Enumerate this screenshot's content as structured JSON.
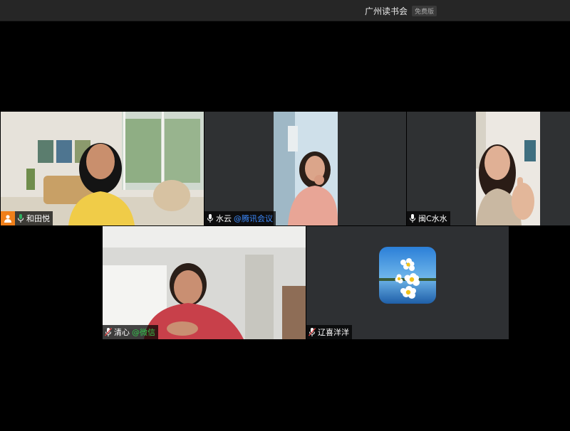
{
  "window": {
    "title": "广州读书会",
    "edition_badge": "免费版"
  },
  "participants": [
    {
      "name": "和田悦",
      "source": "",
      "speaking": true,
      "host": true,
      "video": true
    },
    {
      "name": "水云",
      "source": "@腾讯会议",
      "speaking": false,
      "host": false,
      "video": true
    },
    {
      "name": "闽C水水",
      "source": "",
      "speaking": false,
      "host": false,
      "video": true
    },
    {
      "name": "清心",
      "source": "@微信",
      "speaking": false,
      "host": false,
      "video": true
    },
    {
      "name": "辽喜洋洋",
      "source": "",
      "speaking": false,
      "host": false,
      "video": false
    }
  ],
  "colors": {
    "speaking_border": "#2fb061",
    "source_tencent": "#3d8bff",
    "source_wechat": "#36c34d",
    "host_badge": "#ef7f1a",
    "muted_mic": "#e04a4a"
  }
}
